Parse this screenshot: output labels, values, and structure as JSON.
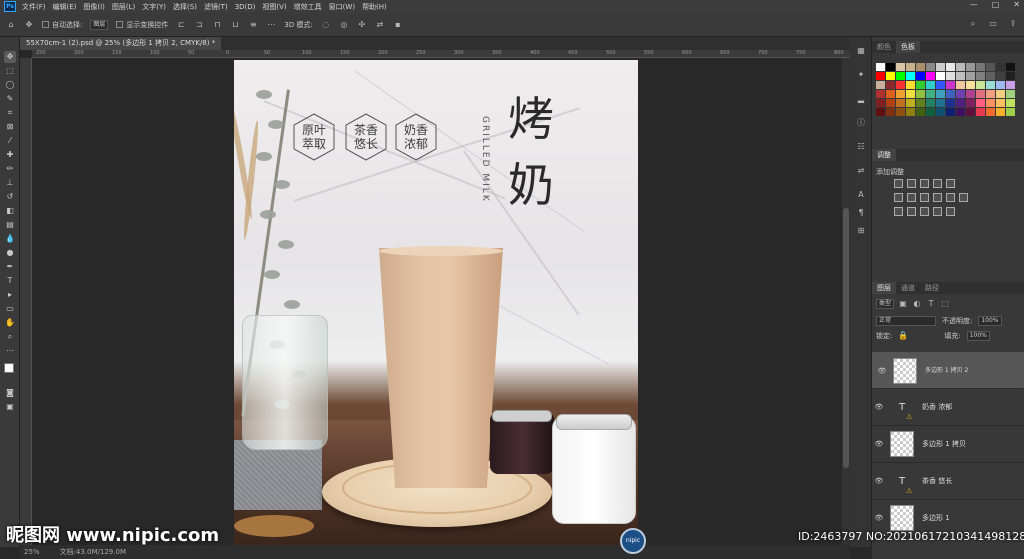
{
  "menubar": {
    "app_logo": "Ps",
    "items": [
      "文件(F)",
      "编辑(E)",
      "图像(I)",
      "图层(L)",
      "文字(Y)",
      "选择(S)",
      "滤镜(T)",
      "3D(D)",
      "视图(V)",
      "增效工具",
      "窗口(W)",
      "帮助(H)"
    ],
    "window_controls": [
      "—",
      "□",
      "✕"
    ]
  },
  "options": {
    "auto_select_label": "自动选择:",
    "auto_select_value": "图层",
    "show_transform_label": "显示变换控件",
    "mode_3d_label": "3D 模式:"
  },
  "document": {
    "tab_title": "55X70cm-1 (2).psd @ 25% (多边形 1 拷贝 2, CMYK/8) *"
  },
  "ruler_ticks": [
    "250",
    "200",
    "150",
    "100",
    "50",
    "0",
    "50",
    "100",
    "150",
    "200",
    "250",
    "300",
    "350",
    "400",
    "450",
    "500",
    "550",
    "600",
    "650",
    "700",
    "750",
    "800"
  ],
  "poster": {
    "hex_labels": [
      {
        "line1": "原叶",
        "line2": "萃取"
      },
      {
        "line1": "茶香",
        "line2": "悠长"
      },
      {
        "line1": "奶香",
        "line2": "浓郁"
      }
    ],
    "title_char1": "烤",
    "title_char2": "奶",
    "title_en": "GRILLED MILK"
  },
  "statusbar": {
    "zoom": "25%",
    "doc_info": "文档:43.0M/129.0M"
  },
  "panels": {
    "top_tabs": [
      "颜色",
      "色板"
    ],
    "top_active": "色板",
    "swatch_colors": [
      "#ffffff",
      "#000000",
      "#d9c7a6",
      "#c8b08a",
      "#aa8f6a",
      "#888888",
      "#cccccc",
      "#e8e8e8",
      "#bbbbbb",
      "#999999",
      "#777777",
      "#555555",
      "#333333",
      "#111111",
      "#ff0000",
      "#ffff00",
      "#00ff00",
      "#00ffff",
      "#0000ff",
      "#ff00ff",
      "#ffffff",
      "#e0e0e0",
      "#c0c0c0",
      "#a0a0a0",
      "#808080",
      "#606060",
      "#404040",
      "#202020",
      "#c8b09a",
      "#8a2a2a",
      "#ff3333",
      "#ffdd33",
      "#33cc33",
      "#33cccc",
      "#3355ff",
      "#cc33cc",
      "#f4c7a0",
      "#f7e09a",
      "#c9e59a",
      "#9adbd6",
      "#a0b8f0",
      "#c8a0e8",
      "#b03030",
      "#e06020",
      "#f0a030",
      "#f0e040",
      "#90c040",
      "#40b080",
      "#40a0c0",
      "#4060c0",
      "#7040b0",
      "#b04090",
      "#e07080",
      "#f0a080",
      "#f0d080",
      "#a0d080",
      "#802020",
      "#b04010",
      "#c07020",
      "#c0b020",
      "#608020",
      "#208060",
      "#207090",
      "#203090",
      "#502080",
      "#802060",
      "#ff6080",
      "#ff9060",
      "#ffc060",
      "#c0e060",
      "#601010",
      "#803010",
      "#905010",
      "#908010",
      "#406010",
      "#106040",
      "#105070",
      "#102070",
      "#401060",
      "#601040",
      "#e63950",
      "#f06b2e",
      "#f7b02c",
      "#9fd04a"
    ],
    "adjust_tab": "调整",
    "adjust_add_label": "添加调整",
    "layer_tabs": [
      "图层",
      "通道",
      "路径"
    ],
    "layer_active": "图层",
    "filter_label": "类型",
    "blend_mode": "正常",
    "opacity_label": "不透明度:",
    "opacity_value": "100%",
    "lock_label": "锁定:",
    "fill_label": "填充:",
    "fill_value": "100%",
    "layers": [
      {
        "name": "多边形 1 拷贝 2",
        "type": "shape",
        "selected": true
      },
      {
        "name": "奶香 浓郁",
        "type": "text",
        "selected": false
      },
      {
        "name": "多边形 1 拷贝",
        "type": "shape",
        "selected": false
      },
      {
        "name": "茶香 悠长",
        "type": "text",
        "selected": false
      },
      {
        "name": "多边形 1",
        "type": "shape",
        "selected": false
      }
    ]
  },
  "watermark": {
    "site": "昵图网 www.nipic.com",
    "id_text": "ID:2463797 NO:20210617210341498128",
    "logo_text": "nipic"
  }
}
